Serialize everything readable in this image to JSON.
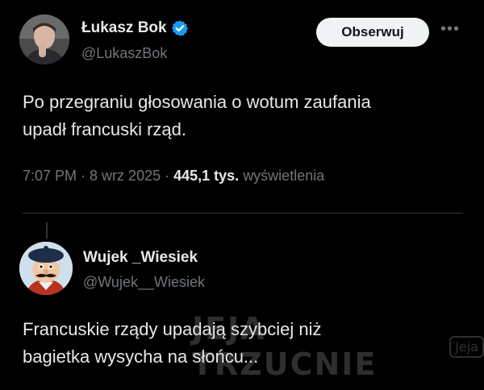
{
  "tweet": {
    "author": {
      "display_name": "Łukasz Bok",
      "handle": "@LukaszBok",
      "verified": true,
      "avatar_icon": "user-photo-avatar"
    },
    "follow_label": "Obserwuj",
    "more_icon": "more-dots-icon",
    "text_lines": [
      "Po przegraniu głosowania o wotum zaufania",
      "upadł francuski rząd."
    ],
    "time": "7:07 PM",
    "separator": "·",
    "date": "8 wrz 2025",
    "views_count": "445,1 tys.",
    "views_label": "wyświetlenia"
  },
  "reply": {
    "author": {
      "display_name": "Wujek _Wiesiek",
      "handle": "@Wujek__Wiesiek",
      "avatar_icon": "cartoon-man-beret-avatar"
    },
    "text_lines": [
      "Francuskie rządy upadają szybciej niż",
      "bagietka wysycha na słońcu..."
    ]
  },
  "watermark": {
    "text": "JEJA TRZUCNIE",
    "badge": "Jeja"
  },
  "colors": {
    "background": "#000000",
    "text_primary": "#e7e9ea",
    "text_secondary": "#71767b",
    "verified_blue": "#1d9bf0",
    "button_bg": "#eff3f4"
  }
}
